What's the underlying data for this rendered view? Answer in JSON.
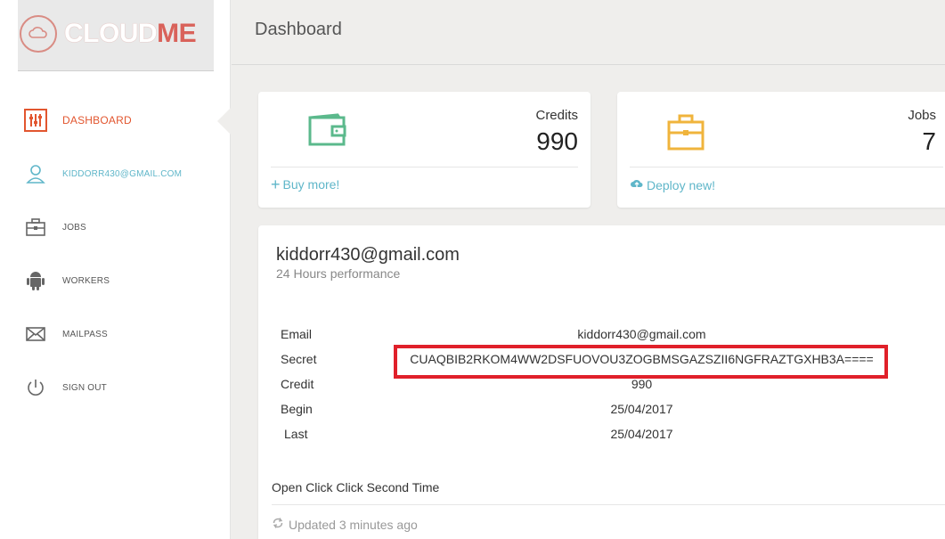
{
  "brand": {
    "cloud": "CLOUD",
    "me": "ME"
  },
  "header": {
    "title": "Dashboard"
  },
  "sidebar": {
    "items": [
      {
        "label": "DASHBOARD",
        "icon": "sliders-icon"
      },
      {
        "label": "KIDDORR430@GMAIL.COM",
        "icon": "user-icon"
      },
      {
        "label": "JOBS",
        "icon": "briefcase-icon"
      },
      {
        "label": "WORKERS",
        "icon": "android-icon"
      },
      {
        "label": "MAILPASS",
        "icon": "envelope-icon"
      },
      {
        "label": "SIGN OUT",
        "icon": "power-icon"
      }
    ]
  },
  "stats": {
    "credits": {
      "label": "Credits",
      "value": "990",
      "link": "Buy more!",
      "link_icon": "plus-icon",
      "icon": "wallet-icon"
    },
    "jobs": {
      "label": "Jobs",
      "value": "7",
      "link": "Deploy new!",
      "link_icon": "cloud-upload-icon",
      "icon": "briefcase-icon"
    }
  },
  "profile": {
    "name": "kiddorr430@gmail.com",
    "subtitle": "24 Hours performance",
    "rows": [
      {
        "key": "Email",
        "value": "kiddorr430@gmail.com"
      },
      {
        "key": "Secret",
        "value": "CUAQBIB2RKOM4WW2DSFUOVOU3ZOGBMSGAZSZII6NGFRAZTGXHB3A===="
      },
      {
        "key": "Credit",
        "value": "990"
      },
      {
        "key": "Begin",
        "value": "25/04/2017"
      },
      {
        "key": "Last",
        "value": "25/04/2017"
      }
    ],
    "note": "Open Click Click Second Time",
    "updated": "Updated 3 minutes ago"
  },
  "colors": {
    "accent": "#e2562f",
    "link": "#5fb6c9",
    "wallet": "#5bb98c",
    "briefcase": "#f0b43c",
    "highlight": "#e0202a"
  }
}
